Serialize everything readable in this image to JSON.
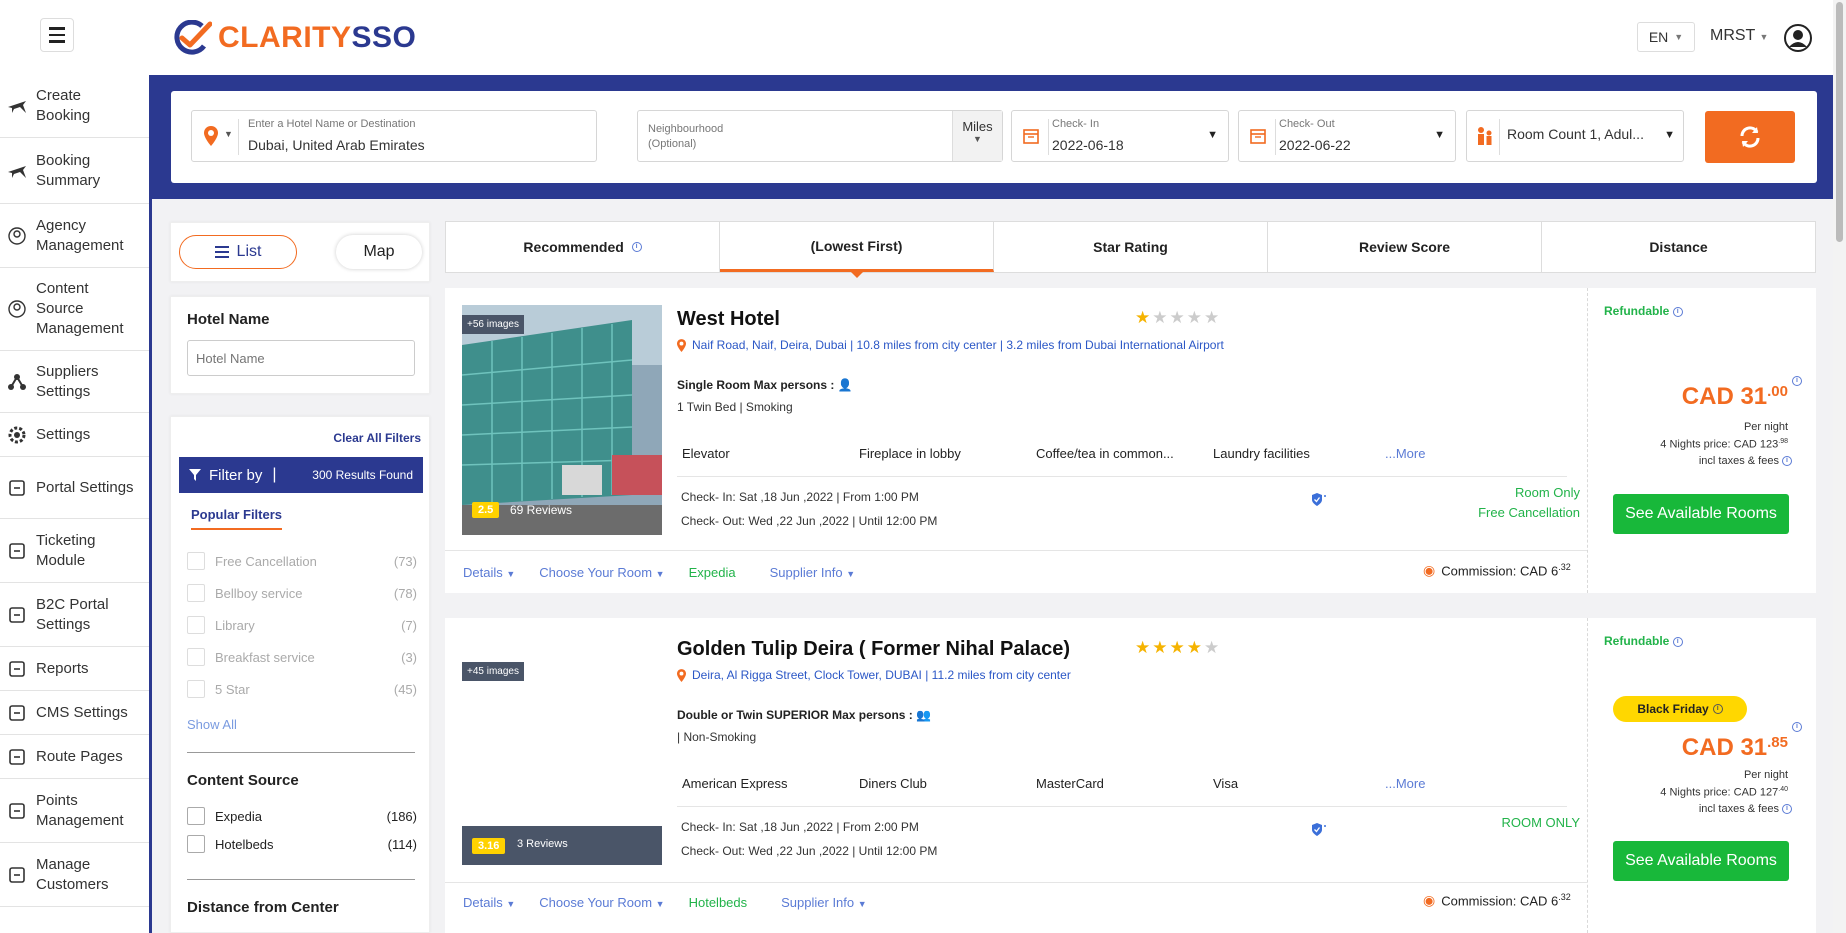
{
  "header": {
    "logo_text_1": "CLARITY",
    "logo_text_2": "SSO",
    "language": "EN",
    "user": "MRST"
  },
  "sidebar": {
    "items": [
      {
        "label": "Create Booking",
        "icon": "plane-icon"
      },
      {
        "label": "Booking Summary",
        "icon": "plane-landing-icon"
      },
      {
        "label": "Agency Management",
        "icon": "agency-icon"
      },
      {
        "label": "Content Source Management",
        "icon": "content-source-icon"
      },
      {
        "label": "Suppliers Settings",
        "icon": "suppliers-icon"
      },
      {
        "label": "Settings",
        "icon": "gear-icon"
      },
      {
        "label": "Portal Settings",
        "icon": "portal-icon"
      },
      {
        "label": "Ticketing Module",
        "icon": "ticket-icon"
      },
      {
        "label": "B2C Portal Settings",
        "icon": "b2c-icon"
      },
      {
        "label": "Reports",
        "icon": "reports-icon"
      },
      {
        "label": "CMS Settings",
        "icon": "cms-icon"
      },
      {
        "label": "Route Pages",
        "icon": "route-icon"
      },
      {
        "label": "Points Management",
        "icon": "points-icon"
      },
      {
        "label": "Manage Customers",
        "icon": "customers-icon"
      }
    ]
  },
  "search": {
    "destination_label": "Enter a Hotel Name or Destination",
    "destination_value": "Dubai, United Arab Emirates",
    "neighbourhood_label": "Neighbourhood",
    "neighbourhood_sub": "(Optional)",
    "units": "Miles",
    "checkin_label": "Check- In",
    "checkin_value": "2022-06-18",
    "checkout_label": "Check- Out",
    "checkout_value": "2022-06-22",
    "rooms_value": "Room Count 1, Adul..."
  },
  "view_toggle": {
    "list": "List",
    "map": "Map"
  },
  "filters": {
    "hotel_name_title": "Hotel Name",
    "hotel_name_placeholder": "Hotel Name",
    "clear_all": "Clear All Filters",
    "filter_by": "Filter by",
    "results": "300 Results Found",
    "popular_title": "Popular Filters",
    "popular": [
      {
        "name": "Free Cancellation",
        "count": "(73)"
      },
      {
        "name": "Bellboy service",
        "count": "(78)"
      },
      {
        "name": "Library",
        "count": "(7)"
      },
      {
        "name": "Breakfast service",
        "count": "(3)"
      },
      {
        "name": "5 Star",
        "count": "(45)"
      }
    ],
    "show_all": "Show All",
    "content_source_title": "Content Source",
    "content_sources": [
      {
        "name": "Expedia",
        "count": "(186)"
      },
      {
        "name": "Hotelbeds",
        "count": "(114)"
      }
    ],
    "distance_title": "Distance from Center"
  },
  "sort_tabs": [
    "Recommended",
    "(Lowest First)",
    "Star Rating",
    "Review Score",
    "Distance"
  ],
  "hotels": [
    {
      "images": "+56 images",
      "review_score": "2.5",
      "reviews": "69 Reviews",
      "name": "West Hotel",
      "stars": 1,
      "address": "Naif Road, Naif, Deira, Dubai | 10.8 miles from city center | 3.2 miles from Dubai International Airport",
      "room": "Single Room Max persons :",
      "room_sub": "1 Twin Bed | Smoking",
      "amenities": [
        "Elevator",
        "Fireplace in lobby",
        "Coffee/tea in common...",
        "Laundry facilities"
      ],
      "more": "...More",
      "checkin": "Check- In: Sat ,18 Jun ,2022 | From 1:00 PM",
      "checkout": "Check- Out: Wed ,22 Jun ,2022 | Until 12:00 PM",
      "board_1": "Room Only",
      "board_2": "Free Cancellation",
      "details": "Details",
      "choose": "Choose Your Room",
      "supplier": "Expedia",
      "supplier_info": "Supplier Info",
      "commission": "Commission: CAD 6",
      "commission_dec": ".32",
      "refundable": "Refundable",
      "price_main": "CAD 31",
      "price_dec": ".00",
      "per_night": "Per night",
      "nights_price": "4 Nights price: CAD 123",
      "nights_dec": ".98",
      "incl": "incl taxes & fees",
      "cta": "See Available Rooms"
    },
    {
      "images": "+45 images",
      "review_score": "3.16",
      "reviews": "3 Reviews",
      "name": "Golden Tulip Deira ( Former Nihal Palace)",
      "stars": 4,
      "address": "Deira, Al Rigga Street, Clock Tower, DUBAI | 11.2 miles from city center",
      "room": "Double or Twin SUPERIOR Max persons :",
      "room_sub": "| Non-Smoking",
      "amenities": [
        "American Express",
        "Diners Club",
        "MasterCard",
        "Visa"
      ],
      "more": "...More",
      "checkin": "Check- In: Sat ,18 Jun ,2022 | From 2:00 PM",
      "checkout": "Check- Out: Wed ,22 Jun ,2022 | Until 12:00 PM",
      "board_1": "ROOM ONLY",
      "board_2": "",
      "details": "Details",
      "choose": "Choose Your Room",
      "supplier": "Hotelbeds",
      "supplier_info": "Supplier Info",
      "commission": "Commission: CAD 6",
      "commission_dec": ".32",
      "refundable": "Refundable",
      "promo": "Black Friday",
      "price_main": "CAD 31",
      "price_dec": ".85",
      "per_night": "Per night",
      "nights_price": "4 Nights price: CAD 127",
      "nights_dec": ".40",
      "incl": "incl taxes & fees",
      "cta": "See Available Rooms"
    }
  ],
  "colors": {
    "brand_blue": "#2b3990",
    "brand_orange": "#f26b21",
    "cta_green": "#18b83a"
  }
}
